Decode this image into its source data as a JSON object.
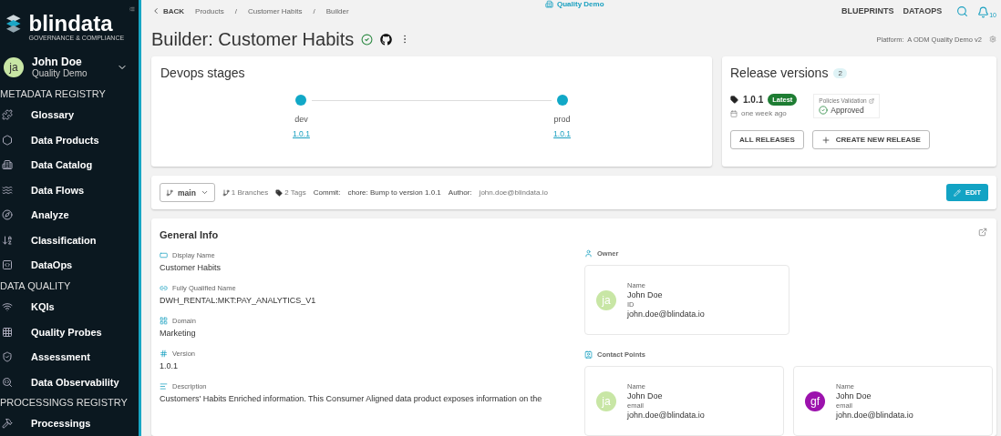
{
  "sidebar": {
    "brand": "blindata",
    "tagline": "GOVERNANCE & COMPLIANCE",
    "user": {
      "initials": "ja",
      "name": "John Doe",
      "tenant": "Quality Demo"
    },
    "sections": [
      {
        "title": "METADATA REGISTRY",
        "items": [
          "Glossary",
          "Data Products",
          "Data Catalog",
          "Data Flows",
          "Analyze",
          "Classification",
          "DataOps"
        ]
      },
      {
        "title": "DATA QUALITY",
        "items": [
          "KQIs",
          "Quality Probes",
          "Assessment",
          "Data Observability"
        ]
      },
      {
        "title": "PROCESSINGS REGISTRY",
        "items": [
          "Processings"
        ]
      }
    ]
  },
  "header": {
    "back": "BACK",
    "breadcrumbs": [
      "Products",
      "Customer Habits",
      "Builder"
    ],
    "separator": "/",
    "tenant": "Quality Demo",
    "nav": [
      "BLUEPRINTS",
      "DATAOPS"
    ],
    "notifications": "10"
  },
  "title": "Builder: Customer Habits",
  "platform": {
    "label": "Platform:",
    "value": "A ODM Quality Demo v2"
  },
  "devops": {
    "title": "Devops stages",
    "stages": [
      {
        "name": "dev",
        "version": "1.0.1"
      },
      {
        "name": "prod",
        "version": "1.0.1"
      }
    ]
  },
  "releases": {
    "title": "Release versions",
    "count": "2",
    "version": "1.0.1",
    "badge": "Latest",
    "date": "one week ago",
    "policy_label": "Policies Validation",
    "policy_status": "Approved",
    "buttons": [
      "ALL RELEASES",
      "CREATE NEW RELEASE"
    ]
  },
  "repo": {
    "branch": "main",
    "branches": "1 Branches",
    "tags": "2 Tags",
    "commit_label": "Commit:",
    "commit": "chore: Bump to version 1.0.1",
    "author_label": "Author:",
    "author": "john.doe@blindata.io",
    "edit": "EDIT"
  },
  "general": {
    "title": "General Info",
    "fields": [
      {
        "label": "Display Name",
        "value": "Customer Habits"
      },
      {
        "label": "Fully Qualified Name",
        "value": "DWH_RENTAL:MKT:PAY_ANALYTICS_V1"
      },
      {
        "label": "Domain",
        "value": "Marketing"
      },
      {
        "label": "Version",
        "value": "1.0.1"
      },
      {
        "label": "Description",
        "value": "Customers' Habits Enriched information. This Consumer Aligned data product exposes information on the"
      }
    ],
    "owner": {
      "title": "Owner",
      "card": {
        "initials": "ja",
        "color": "#c8e6a5",
        "rows": [
          {
            "label": "Name",
            "value": "John Doe"
          },
          {
            "label": "ID",
            "value": "john.doe@blindata.io"
          }
        ]
      }
    },
    "contacts": {
      "title": "Contact Points",
      "cards": [
        {
          "initials": "ja",
          "color": "#c8e6a5",
          "rows": [
            {
              "label": "Name",
              "value": "John Doe"
            },
            {
              "label": "email",
              "value": "john.doe@blindata.io"
            }
          ]
        },
        {
          "initials": "gf",
          "color": "#9c12ad",
          "rows": [
            {
              "label": "Name",
              "value": "John Doe"
            },
            {
              "label": "email",
              "value": "john.doe@blindata.io"
            }
          ]
        }
      ]
    }
  }
}
